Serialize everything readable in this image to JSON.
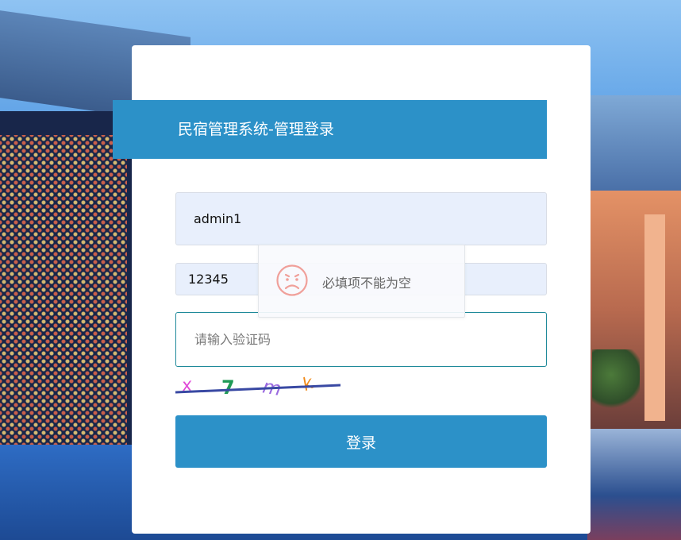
{
  "header": {
    "title": "民宿管理系统-管理登录"
  },
  "form": {
    "username_value": "admin1",
    "password_value": "12345",
    "captcha_placeholder": "请输入验证码",
    "captcha_chars": [
      "x",
      "7",
      "m",
      "k"
    ],
    "captcha_colors": [
      "#e04ad8",
      "#1f9a56",
      "#9a6ae0",
      "#f08a1a"
    ],
    "login_label": "登录"
  },
  "toast": {
    "message": "必填项不能为空",
    "icon": "sad-face-icon"
  },
  "colors": {
    "primary": "#2c91c8",
    "focus_border": "#1f8a9a",
    "toast_icon": "#f0a09a"
  }
}
